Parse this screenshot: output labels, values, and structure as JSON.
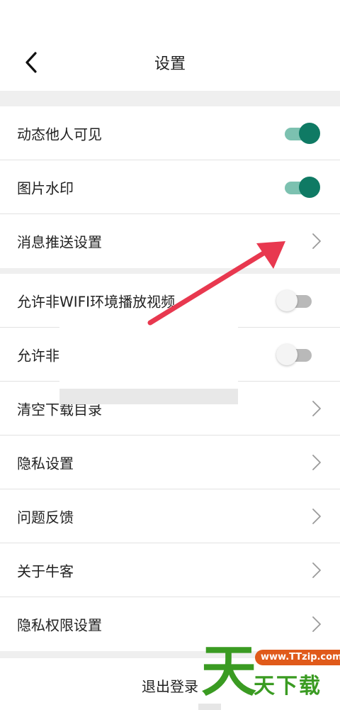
{
  "header": {
    "title": "设置",
    "back_icon": "chevron-left-icon"
  },
  "sections": [
    {
      "items": [
        {
          "label": "动态他人可见",
          "control": "toggle",
          "state": "on"
        },
        {
          "label": "图片水印",
          "control": "toggle",
          "state": "on"
        },
        {
          "label": "消息推送设置",
          "control": "chevron"
        }
      ]
    },
    {
      "items": [
        {
          "label": "允许非WIFI环境播放视频",
          "control": "toggle",
          "state": "off"
        },
        {
          "label": "允许非",
          "control": "toggle",
          "state": "off"
        },
        {
          "label": "清空下载目录",
          "control": "chevron"
        },
        {
          "label": "隐私设置",
          "control": "chevron"
        },
        {
          "label": "问题反馈",
          "control": "chevron"
        },
        {
          "label": "关于牛客",
          "control": "chevron"
        },
        {
          "label": "隐私权限设置",
          "control": "chevron"
        }
      ]
    }
  ],
  "logout": {
    "label": "退出登录"
  },
  "colors": {
    "toggle_on_knob": "#0f7a64",
    "toggle_on_track": "#7cc1b0",
    "toggle_off_track": "#b9b9b9",
    "annotation_arrow": "#e8384f",
    "section_gap": "#efefef"
  },
  "watermark": {
    "big_char": "天",
    "url": "www.TTzip.com",
    "text": "天下载"
  }
}
